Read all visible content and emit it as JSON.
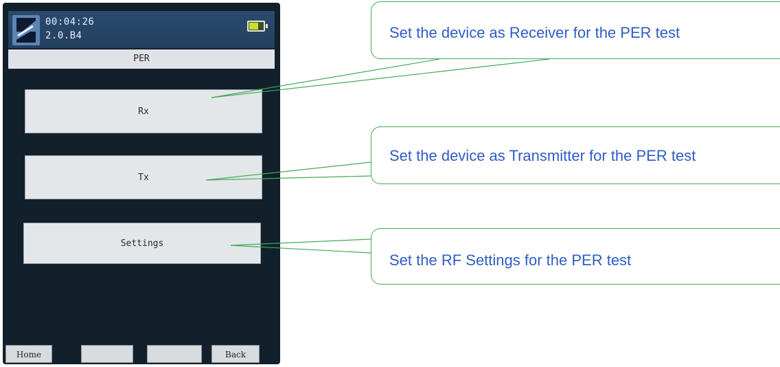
{
  "device": {
    "clock": "00:04:26",
    "version": "2.0.B4",
    "title": "PER",
    "buttons": {
      "rx": "Rx",
      "tx": "Tx",
      "settings": "Settings"
    },
    "softkeys": {
      "home": "Home",
      "key2": "",
      "key3": "",
      "back": "Back"
    }
  },
  "callouts": [
    {
      "text": "Set the device as Receiver for the PER test"
    },
    {
      "text": "Set the device as Transmitter for the PER test"
    },
    {
      "text": "Set the RF Settings for the PER test"
    }
  ],
  "colors": {
    "callout_border": "#42a956",
    "callout_text": "#2f5cc5",
    "device_bg": "#12202c"
  }
}
